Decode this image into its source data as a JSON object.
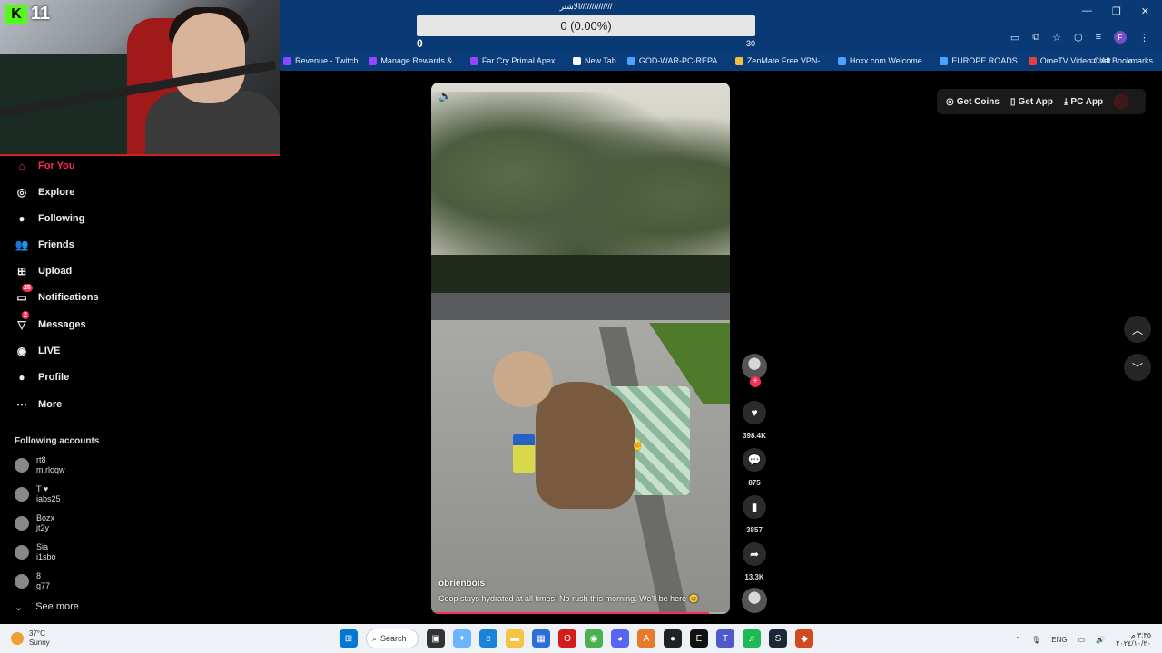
{
  "overlay": {
    "title": "الاشتر//////////////",
    "progress_text": "0 (0.00%)",
    "min": "0",
    "max": "30",
    "progress": 0
  },
  "bookmarks": [
    {
      "label": "Revenue - Twitch",
      "color": "#9147ff"
    },
    {
      "label": "Manage Rewards &...",
      "color": "#9147ff"
    },
    {
      "label": "Far Cry Primal Apex...",
      "color": "#9147ff"
    },
    {
      "label": "New Tab",
      "color": "#ffffff"
    },
    {
      "label": "GOD-WAR-PC-REPA...",
      "color": "#4aa3ff"
    },
    {
      "label": "ZenMate Free VPN-...",
      "color": "#f0c040"
    },
    {
      "label": "Hoxx.com Welcome...",
      "color": "#4aa3ff"
    },
    {
      "label": "EUROPE ROADS",
      "color": "#4aa3ff"
    },
    {
      "label": "OmeTV Video Chat...",
      "color": "#e04040"
    }
  ],
  "bookmarks_all": "All Bookmarks",
  "bookmarks_more": "»",
  "stream": {
    "badge": "K",
    "viewer_count": "11"
  },
  "sidebar": {
    "items": [
      {
        "label": "For You",
        "icon": "home-icon",
        "glyph": "⌂",
        "active": true
      },
      {
        "label": "Explore",
        "icon": "compass-icon",
        "glyph": "◎"
      },
      {
        "label": "Following",
        "icon": "following-avatar-icon",
        "glyph": "●"
      },
      {
        "label": "Friends",
        "icon": "friends-icon",
        "glyph": "👥"
      },
      {
        "label": "Upload",
        "icon": "upload-icon",
        "glyph": "⊞"
      },
      {
        "label": "Notifications",
        "icon": "notifications-icon",
        "glyph": "▭",
        "badge": "25"
      },
      {
        "label": "Messages",
        "icon": "messages-icon",
        "glyph": "▽",
        "badge": "2"
      },
      {
        "label": "LIVE",
        "icon": "live-icon",
        "glyph": "◉"
      },
      {
        "label": "Profile",
        "icon": "profile-icon",
        "glyph": "●"
      },
      {
        "label": "More",
        "icon": "more-icon",
        "glyph": "⋯"
      }
    ],
    "following_title": "Following accounts",
    "accounts": [
      {
        "name": "rt8",
        "handle": "m.rloqw"
      },
      {
        "name": "T ♥",
        "handle": "iabs25"
      },
      {
        "name": "Bozx",
        "handle": "jt2y"
      },
      {
        "name": "Sia",
        "handle": "i1sbo"
      },
      {
        "name": "8",
        "handle": "g77"
      }
    ],
    "see_more": "See more"
  },
  "video": {
    "author": "obrienbois",
    "caption": "Coop stays hydrated at all times! No rush this morning. We'll be here 😊",
    "progress": 0.93
  },
  "actions": {
    "likes": "398.4K",
    "comments": "875",
    "saves": "3857",
    "shares": "13.3K"
  },
  "top_actions": {
    "coins": "Get Coins",
    "app": "Get App",
    "pc_app": "PC App"
  },
  "taskbar": {
    "temp": "37°C",
    "weather": "Sunny",
    "search": "Search",
    "lang": "ENG",
    "time": "٣:٣٥ م",
    "date": "٢٠٢٤/١٠/٢٠"
  },
  "colors": {
    "accent": "#fe2c55",
    "chrome": "#0a3a75",
    "kick": "#53fc18"
  }
}
